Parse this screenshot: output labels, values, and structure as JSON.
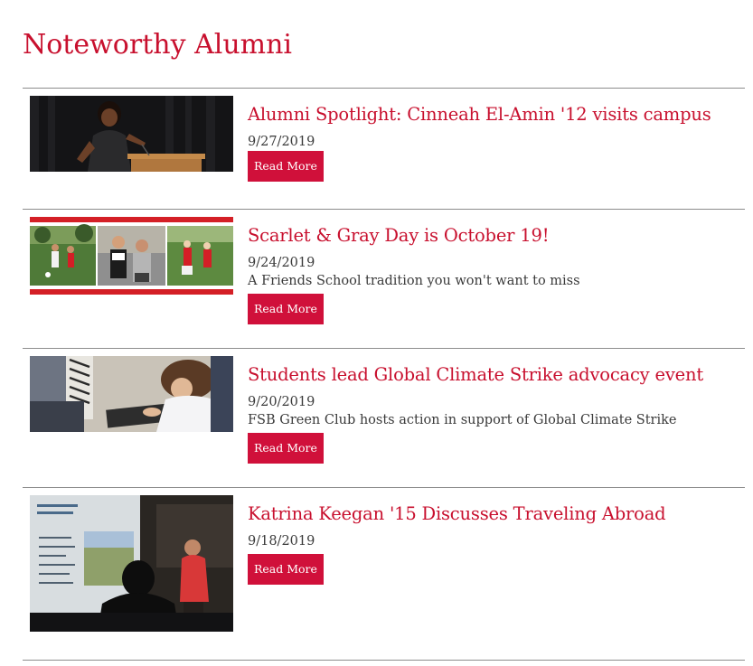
{
  "page": {
    "title": "Noteworthy Alumni"
  },
  "colors": {
    "accent": "#c8102e",
    "button": "#d0103a",
    "divider": "#8c8c8c",
    "body_text": "#3a3a3a"
  },
  "items": [
    {
      "headline": "Alumni Spotlight: Cinneah El-Amin '12 visits campus",
      "date": "9/27/2019",
      "summary": "",
      "button": "Read More"
    },
    {
      "headline": "Scarlet & Gray Day is October 19!",
      "date": "9/24/2019",
      "summary": "A Friends School tradition you won't want to miss",
      "button": "Read More"
    },
    {
      "headline": "Students lead Global Climate Strike advocacy event",
      "date": "9/20/2019",
      "summary": "FSB Green Club hosts action in support of Global Climate Strike",
      "button": "Read More"
    },
    {
      "headline": "Katrina Keegan '15 Discusses Traveling Abroad",
      "date": "9/18/2019",
      "summary": "",
      "button": "Read More"
    }
  ]
}
